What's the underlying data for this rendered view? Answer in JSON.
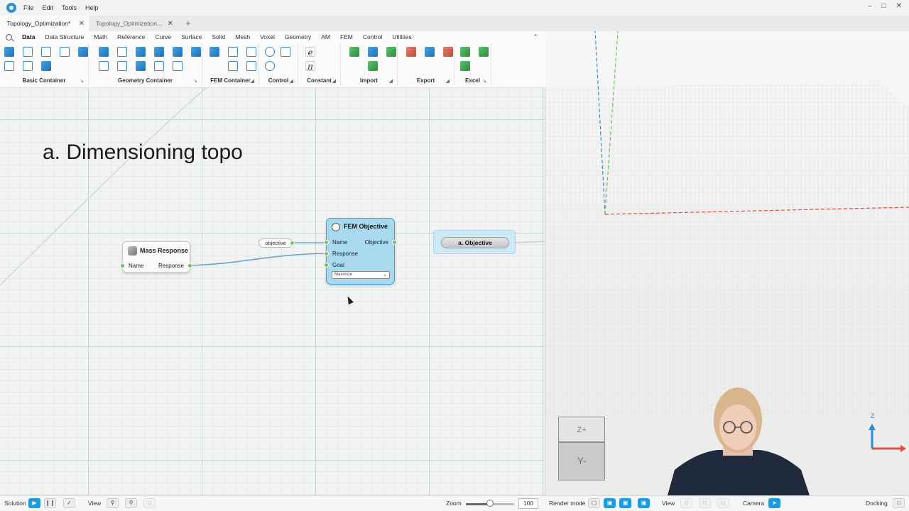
{
  "menubar": {
    "items": [
      "File",
      "Edit",
      "Tools",
      "Help"
    ]
  },
  "tabs": [
    {
      "label": "Topology_Optimization*",
      "active": true
    },
    {
      "label": "Topology_Optimization...",
      "active": false
    }
  ],
  "ribbon": {
    "tabs": [
      "Data",
      "Data Structure",
      "Math",
      "Reference",
      "Curve",
      "Surface",
      "Solid",
      "Mesh",
      "Voxel",
      "Geometry",
      "AM",
      "FEM",
      "Control",
      "Utilities"
    ],
    "active_tab": "Data",
    "groups": [
      "Basic Container",
      "Geometry Container",
      "FEM Container",
      "Control",
      "Constant",
      "Import",
      "Export",
      "Excel"
    ]
  },
  "canvas": {
    "title": "a. Dimensioning topo",
    "nodes": {
      "mass_response": {
        "title": "Mass Response",
        "input": "Name",
        "output": "Response"
      },
      "objective_input": {
        "value": "objective"
      },
      "fem_objective": {
        "title": "FEM Objective",
        "inputs": [
          "Name",
          "Response",
          "Goal"
        ],
        "output": "Objective",
        "goal_value": "Maximize"
      },
      "a_objective": {
        "label": "a. Objective"
      }
    }
  },
  "viewport": {
    "cube_top": "Z+",
    "cube_front": "Y-",
    "axis_label": "Z"
  },
  "statusbar": {
    "solution_label": "Solution",
    "view_label": "View",
    "zoom_label": "Zoom",
    "zoom_value": "100",
    "zoom_fraction": 0.5,
    "render_mode_label": "Render mode",
    "view_label_right": "View",
    "camera_label": "Camera",
    "docking_label": "Docking"
  },
  "colors": {
    "accent": "#1e9be0",
    "fem_node": "#a8d9ee",
    "port": "#6cc25e",
    "x_axis": "#e0503c",
    "y_axis": "#6cc25e",
    "z_axis": "#2a8fd8"
  }
}
